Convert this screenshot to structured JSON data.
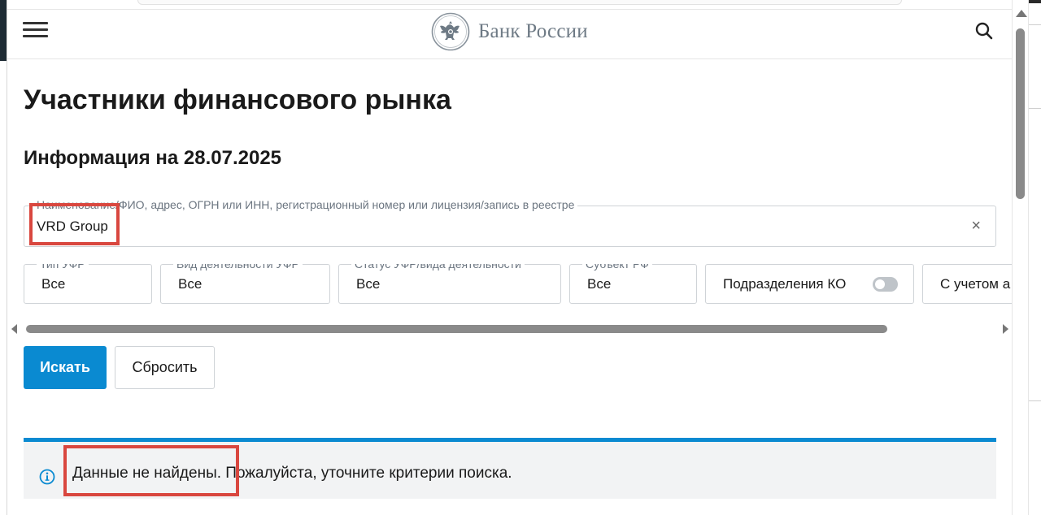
{
  "header": {
    "menu_icon": "hamburger-icon",
    "logo_text": "Банк России",
    "logo_icon": "double-headed-eagle-emblem",
    "search_icon": "search-icon"
  },
  "page": {
    "title": "Участники финансового рынка",
    "info_date": "Информация на 28.07.2025"
  },
  "search": {
    "label": "Наименование/ФИО, адрес, ОГРН или ИНН, регистрационный номер или лицензия/запись в реестре",
    "value": "VRD Group",
    "clear_icon": "close-icon",
    "clear_glyph": "×"
  },
  "filters": {
    "type": {
      "label": "Тип УФР",
      "value": "Все"
    },
    "activity": {
      "label": "Вид деятельности УФР",
      "value": "Все"
    },
    "status": {
      "label": "Статус УФР/вида деятельности",
      "value": "Все"
    },
    "region": {
      "label": "Субъект РФ",
      "value": "Все"
    },
    "branches": {
      "label": "Подразделения КО",
      "enabled": false
    },
    "extra": {
      "label": "С учетом а"
    }
  },
  "buttons": {
    "search_label": "Искать",
    "reset_label": "Сбросить"
  },
  "notice": {
    "icon": "info-icon",
    "text": "Данные не найдены. Пожалуйста, уточните критерии поиска."
  },
  "colors": {
    "accent": "#0a8ad1",
    "highlight": "#d9473f",
    "notice_bg": "#f2f3f4",
    "logo_text": "#6e7a85"
  }
}
